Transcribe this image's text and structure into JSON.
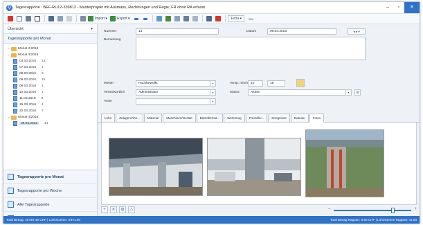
{
  "window": {
    "app_icon": "Q",
    "title": "Tagesrapporte : BEF-RU12-339812 - Musterprojekt  mit Ausmass, Rechnungen und Regie, FR ohne RA erfasst",
    "minimize": "–",
    "maximize": "▫",
    "close": "✕"
  },
  "toolbar": {
    "import_label": "Import ▾",
    "export_label": "Export ▾",
    "extra_label": "Extra ▾",
    "icons": [
      "close-red-icon",
      "new-doc-icon",
      "save-icon",
      "delete-icon",
      "grid-icon",
      "copy-icon",
      "filter-icon",
      "print-icon"
    ]
  },
  "sidebar": {
    "header_label": "Übersicht",
    "header_pin": "▾",
    "section_title": "Tagesrapporte pro Monat",
    "tree": [
      {
        "level": 0,
        "type": "folder",
        "label": "Monat 2/2016",
        "count": "",
        "expanded": true
      },
      {
        "level": 0,
        "type": "folder",
        "label": "Monat 3/2016",
        "count": "",
        "expanded": true
      },
      {
        "level": 1,
        "type": "doc",
        "label": "03.03.2016",
        "count": "13"
      },
      {
        "level": 1,
        "type": "doc",
        "label": "07.03.2016",
        "count": "1"
      },
      {
        "level": 1,
        "type": "doc",
        "label": "08.03.2016",
        "count": "2"
      },
      {
        "level": 1,
        "type": "doc",
        "label": "09.03.2016",
        "count": "15"
      },
      {
        "level": 1,
        "type": "doc",
        "label": "09.03.2016",
        "count": "1"
      },
      {
        "level": 1,
        "type": "doc",
        "label": "10.03.2016",
        "count": "1"
      },
      {
        "level": 1,
        "type": "doc",
        "label": "11.03.2016",
        "count": "6"
      },
      {
        "level": 1,
        "type": "doc",
        "label": "15.03.2016",
        "count": "4"
      },
      {
        "level": 1,
        "type": "doc",
        "label": "22.03.2016",
        "count": "7"
      },
      {
        "level": 0,
        "type": "folder",
        "label": "Monat 4/2016",
        "count": "",
        "expanded": true
      },
      {
        "level": 1,
        "type": "doc",
        "label": "06.04.2016",
        "count": "14",
        "selected": true
      }
    ],
    "nav": [
      {
        "label": "Tagesrapporte pro Monat",
        "active": true
      },
      {
        "label": "Tagesrapporte pro Woche",
        "active": false
      },
      {
        "label": "Alle Tagesrapporte",
        "active": false
      },
      {
        "label": "Bereinigen",
        "active": false
      }
    ]
  },
  "form": {
    "nummer_label": "Nummer",
    "nummer_value": "14",
    "datum_label": "Datum",
    "datum_value": "06.04.2016",
    "datum_nav": "◂ ▸ ▾",
    "bemerkung_label": "Bemerkung",
    "wetter_label": "Wetter",
    "wetter_value": "Hochbewölkt",
    "temp_label": "Temp. min/max",
    "temp_min": "10",
    "temp_max": "16",
    "verantwortlich_label": "Verantwortlich",
    "verantwortlich_value": "Administrator",
    "status_label": "Status",
    "status_value": "Aktive",
    "team_label": "Team",
    "team_value": ""
  },
  "tabs": [
    {
      "label": "Lohn",
      "active": false
    },
    {
      "label": "Zulagen/Abz...",
      "active": false
    },
    {
      "label": "Material",
      "active": false
    },
    {
      "label": "Maschinen/Geräte",
      "active": false
    },
    {
      "label": "Betriebsmat...",
      "active": false
    },
    {
      "label": "Werkzeug",
      "active": false
    },
    {
      "label": "Fremdlei...",
      "active": false
    },
    {
      "label": "Ereignisse",
      "active": false
    },
    {
      "label": "Dateien",
      "active": false
    },
    {
      "label": "Fotos",
      "active": true
    }
  ],
  "gallery_tools": [
    "+",
    "✕",
    "⧉",
    "⚠"
  ],
  "zoom": {
    "minus": "–",
    "plus": "+",
    "level": 0.78
  },
  "statusbar": {
    "left": "Total Betrag: 10'487.40 CHF  |  Lohnsumme: 4'871.00",
    "right": "Total Betrag Rapport: 0.00 CHF  |  Lohnsumme Rapport: 41.00"
  },
  "colors": {
    "accent": "#2f73c8",
    "folder": "#e8b84a"
  }
}
